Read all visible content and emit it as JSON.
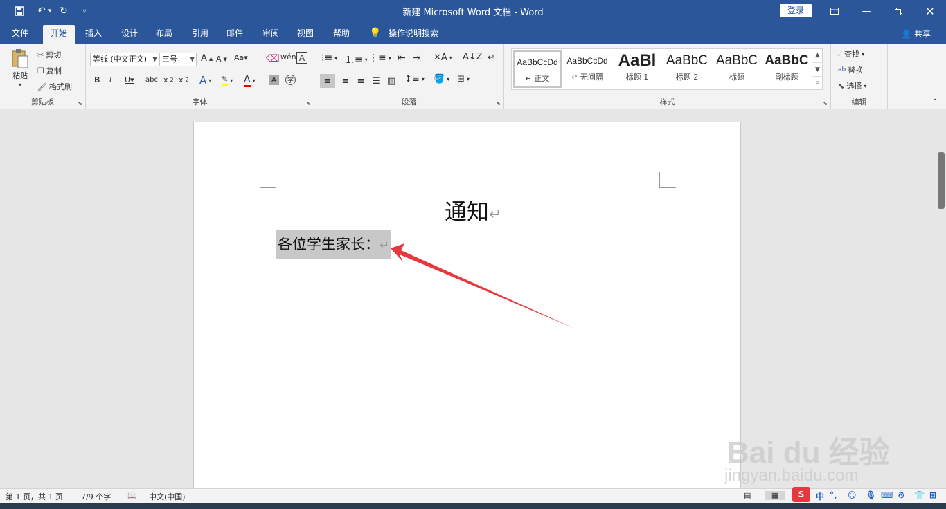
{
  "titlebar": {
    "title": "新建 Microsoft Word 文档  -  Word",
    "login": "登录",
    "icons": [
      "save-icon",
      "undo-icon",
      "redo-icon",
      "customize-icon",
      "ribbon-display-icon",
      "minimize-icon",
      "restore-icon",
      "close-icon"
    ]
  },
  "tabs": [
    {
      "label": "文件"
    },
    {
      "label": "开始"
    },
    {
      "label": "插入"
    },
    {
      "label": "设计"
    },
    {
      "label": "布局"
    },
    {
      "label": "引用"
    },
    {
      "label": "邮件"
    },
    {
      "label": "审阅"
    },
    {
      "label": "视图"
    },
    {
      "label": "帮助"
    },
    {
      "label": "操作说明搜索"
    }
  ],
  "share": "共享",
  "ribbon": {
    "clipboard": {
      "label": "剪贴板",
      "paste": "粘贴",
      "cut": "剪切",
      "copy": "复制",
      "format_painter": "格式刷"
    },
    "font": {
      "label": "字体",
      "font_name": "等线 (中文正文)",
      "font_size": "三号"
    },
    "paragraph": {
      "label": "段落"
    },
    "styles": {
      "label": "样式",
      "items": [
        {
          "sample": "AaBbCcDd",
          "name": "↵ 正文"
        },
        {
          "sample": "AaBbCcDd",
          "name": "↵ 无间隔"
        },
        {
          "sample": "AaBl",
          "name": "标题 1"
        },
        {
          "sample": "AaBbC",
          "name": "标题 2"
        },
        {
          "sample": "AaBbC",
          "name": "标题"
        },
        {
          "sample": "AaBbC",
          "name": "副标题"
        }
      ]
    },
    "editing": {
      "label": "编辑",
      "find": "查找",
      "replace": "替换",
      "select": "选择"
    }
  },
  "document": {
    "title": "通知",
    "line1": "各位学生家长：",
    "paragraph_mark": "↵"
  },
  "watermark": {
    "logo": "Bai du 经验",
    "url": "jingyan.baidu.com"
  },
  "status": {
    "page": "第 1 页，共 1 页",
    "words": "7/9 个字",
    "language": "中文(中国)",
    "ime": "中"
  },
  "colors": {
    "accent": "#2b579a",
    "arrow": "#e8383d",
    "selection": "#c8c8c8"
  }
}
